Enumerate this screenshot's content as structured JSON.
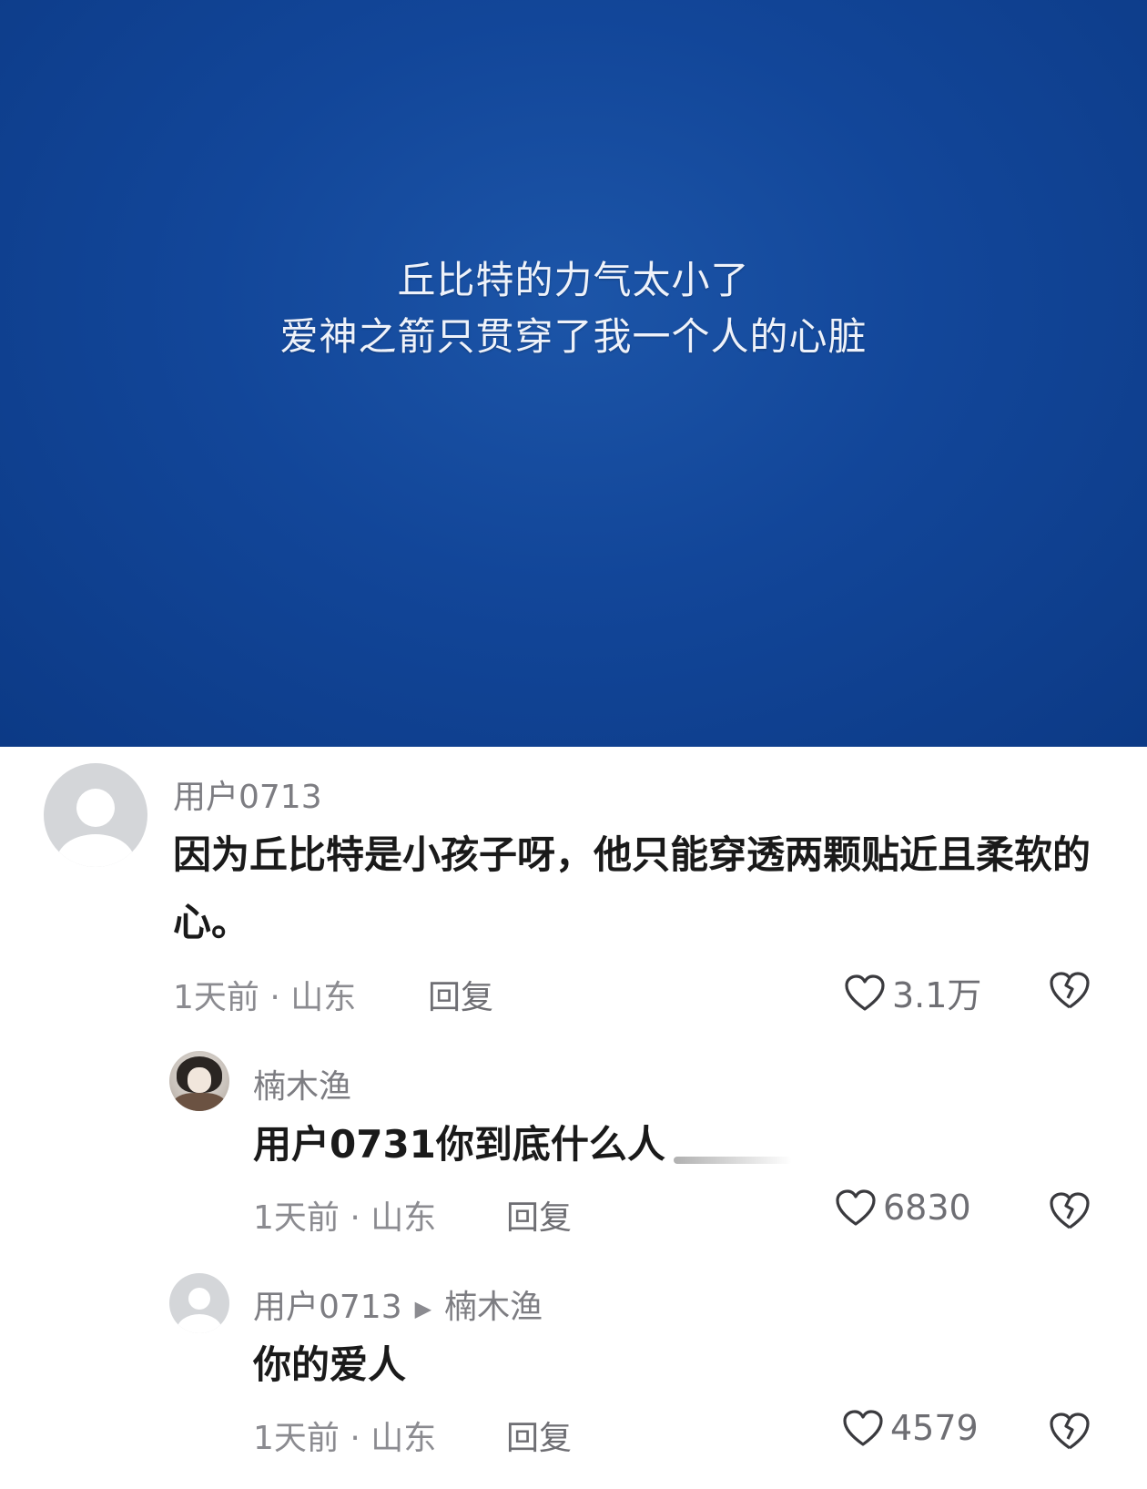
{
  "video": {
    "caption_line1": "丘比特的力气太小了",
    "caption_line2": "爱神之箭只贯穿了我一个人的心脏"
  },
  "comments": [
    {
      "username": "用户0713",
      "text": "因为丘比特是小孩子呀，他只能穿透两颗贴近且柔软的心。",
      "time_location": "1天前 · 山东",
      "reply_label": "回复",
      "likes": "3.1万"
    },
    {
      "username": "楠木渔",
      "text": "用户0731你到底什么人",
      "time_location": "1天前 · 山东",
      "reply_label": "回复",
      "likes": "6830"
    },
    {
      "username": "用户0713",
      "reply_to": "楠木渔",
      "text": "你的爱人",
      "time_location": "1天前 · 山东",
      "reply_label": "回复",
      "likes": "4579"
    }
  ],
  "icons": {
    "like": "heart-outline-icon",
    "dislike": "broken-heart-icon",
    "reply_arrow": "play-arrow-icon"
  },
  "colors": {
    "video_background": "#124699",
    "username": "#7d7d82",
    "comment_text": "#1a1a1a",
    "meta": "#8b8b90"
  }
}
